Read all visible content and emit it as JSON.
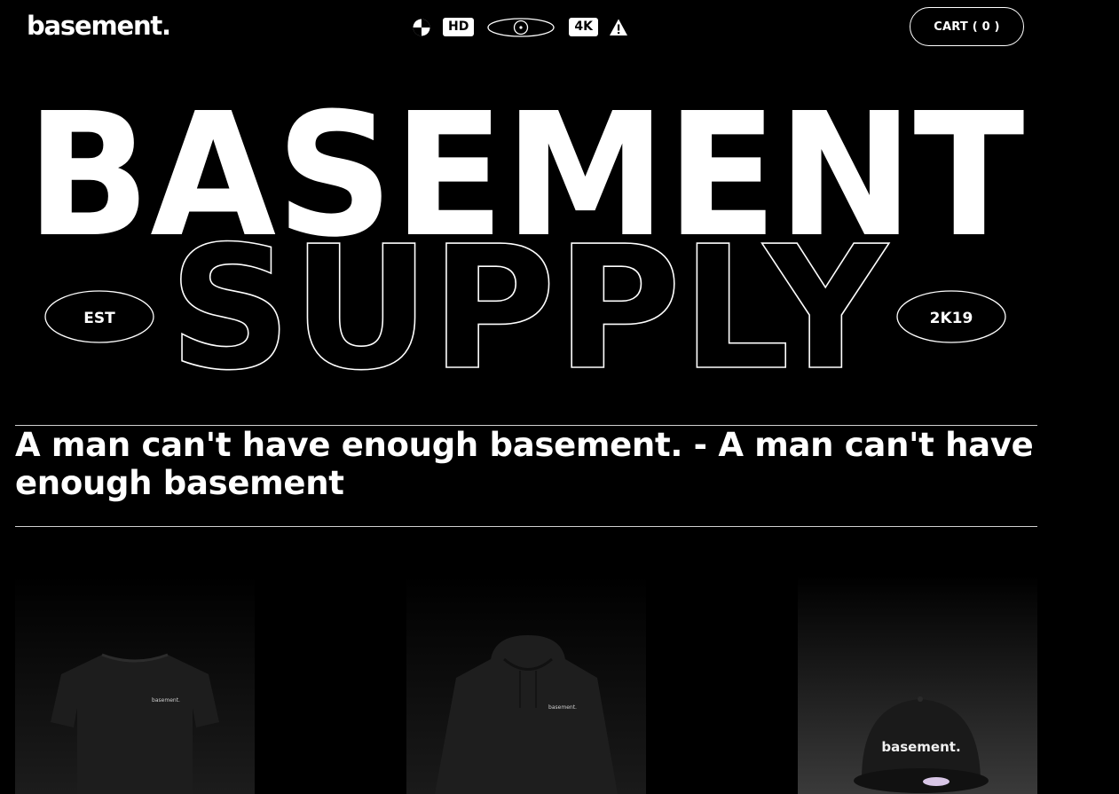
{
  "header": {
    "logo": "basement.",
    "icons": [
      "half-circle-icon",
      "hd-badge",
      "eye-icon",
      "4k-badge",
      "warning-icon"
    ],
    "hd_label": "HD",
    "fourk_label": "4K",
    "cart_label": "CART ( 0 )"
  },
  "hero": {
    "title_line1": "BASEMENT",
    "title_line2": "SUPPLY",
    "left_pill": "EST",
    "right_pill": "2K19"
  },
  "marquee": {
    "text": "A man can't have enough basement. - A man can't have enough basement"
  },
  "products": [
    {
      "kind": "t-shirt",
      "print": "basement."
    },
    {
      "kind": "hoodie",
      "print": "basement."
    },
    {
      "kind": "cap",
      "print": "basement."
    }
  ],
  "colors": {
    "background": "#000000",
    "foreground": "#ffffff",
    "divider": "#cfcfcf"
  }
}
